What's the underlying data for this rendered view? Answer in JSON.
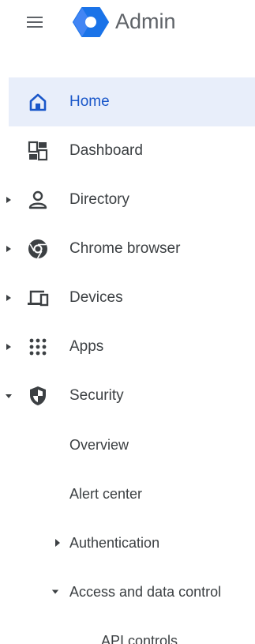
{
  "header": {
    "title": "Admin",
    "menu_icon": "hamburger-menu-icon",
    "logo_icon": "admin-hexagon-logo",
    "brand_color": "#1a73e8"
  },
  "nav": {
    "active_bg": "#e8eefa",
    "active_color": "#1a57c9",
    "items": [
      {
        "label": "Home",
        "icon": "home-icon",
        "active": true
      },
      {
        "label": "Dashboard",
        "icon": "dashboard-icon"
      },
      {
        "label": "Directory",
        "icon": "person-icon",
        "expandable": true
      },
      {
        "label": "Chrome browser",
        "icon": "chrome-icon",
        "expandable": true
      },
      {
        "label": "Devices",
        "icon": "devices-icon",
        "expandable": true
      },
      {
        "label": "Apps",
        "icon": "apps-grid-icon",
        "expandable": true
      },
      {
        "label": "Security",
        "icon": "shield-icon",
        "expanded": true
      }
    ],
    "security_children": [
      {
        "label": "Overview"
      },
      {
        "label": "Alert center"
      },
      {
        "label": "Authentication",
        "expandable": true
      },
      {
        "label": "Access and data control",
        "expanded": true
      }
    ],
    "access_children": [
      {
        "label": "API controls"
      }
    ]
  }
}
